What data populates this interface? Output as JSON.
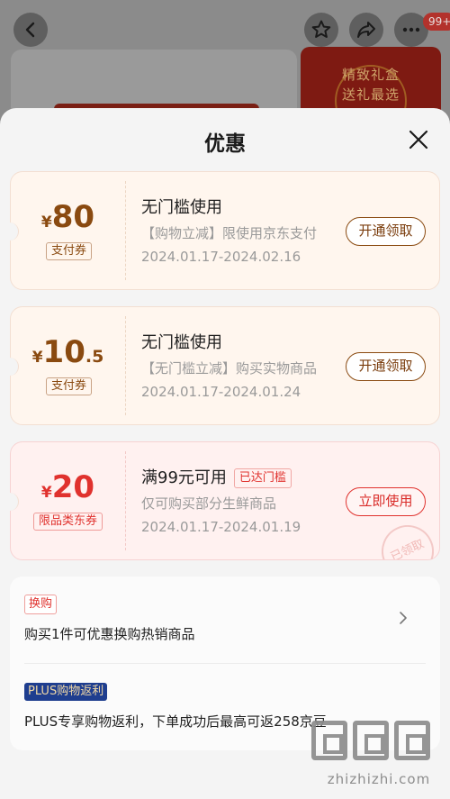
{
  "background": {
    "cart_badge": "99+",
    "banner_line1": "精致礼盒",
    "banner_line2": "送礼最选"
  },
  "sheet": {
    "title": "优惠"
  },
  "coupons": [
    {
      "currency": "¥",
      "amount_int": "80",
      "amount_dec": "",
      "type_tag": "支付券",
      "title": "无门槛使用",
      "status_tag": "",
      "description": "【购物立减】限使用京东支付",
      "validity": "2024.01.17-2024.02.16",
      "action": "开通领取"
    },
    {
      "currency": "¥",
      "amount_int": "10",
      "amount_dec": ".5",
      "type_tag": "支付券",
      "title": "无门槛使用",
      "status_tag": "",
      "description": "【无门槛立减】购买实物商品",
      "validity": "2024.01.17-2024.01.24",
      "action": "开通领取"
    },
    {
      "currency": "¥",
      "amount_int": "20",
      "amount_dec": "",
      "type_tag": "限品类东券",
      "title": "满99元可用",
      "status_tag": "已达门槛",
      "description": "仅可购买部分生鲜商品",
      "validity": "2024.01.17-2024.01.19",
      "action": "立即使用",
      "stamp": "已领取"
    }
  ],
  "promos": {
    "exchange_badge": "换购",
    "exchange_text": "购买1件可优惠换购热销商品",
    "plus_badge": "PLUS购物返利",
    "plus_text": "PLUS专享购物返利，下单成功后最高可返258京豆"
  },
  "watermark": {
    "text": "zhizhizhi.com"
  },
  "colors": {
    "brown": "#8a4a10",
    "red": "#e0322e",
    "plus_blue": "#1f3e8f"
  }
}
